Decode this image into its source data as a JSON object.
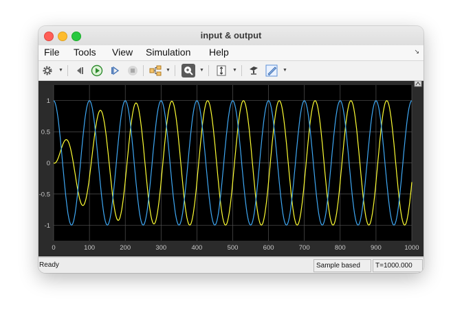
{
  "window": {
    "title": "input & output"
  },
  "menu": [
    "File",
    "Tools",
    "View",
    "Simulation",
    "Help"
  ],
  "toolbar": {
    "icons": [
      "gear-icon",
      "step-back-icon",
      "run-icon",
      "step-forward-icon",
      "stop-icon",
      "signal-selector-icon",
      "zoom-icon",
      "autoscale-icon",
      "style-icon",
      "highlight-icon"
    ]
  },
  "status": {
    "ready": "Ready",
    "mode": "Sample based",
    "time": "T=1000.000"
  },
  "colors": {
    "plot_bg": "#000000",
    "figure_bg": "#2b2b2b",
    "input": "#ffff33",
    "output": "#3fa9f5",
    "grid": "#555555",
    "tick": "#c8c8c8"
  },
  "chart_data": {
    "type": "line",
    "xlim": [
      0,
      1000
    ],
    "ylim": [
      -1.25,
      1.25
    ],
    "xticks": [
      "0",
      "100",
      "200",
      "300",
      "400",
      "500",
      "600",
      "700",
      "800",
      "900",
      "1000"
    ],
    "yticks": [
      "1",
      "0.5",
      "0",
      "-0.5",
      "-1"
    ],
    "grid": true,
    "legend": "none",
    "series": [
      {
        "color": "yellow",
        "signal": "sine",
        "period": 100,
        "phase_shift": 5,
        "start_amplitude": 0,
        "amplitude": 1,
        "settles_by": 350,
        "x_end": 1000
      },
      {
        "color": "blue",
        "signal": "cosine",
        "period": 100,
        "amplitude": 1,
        "x_start": 0,
        "x_end": 1000
      }
    ]
  }
}
